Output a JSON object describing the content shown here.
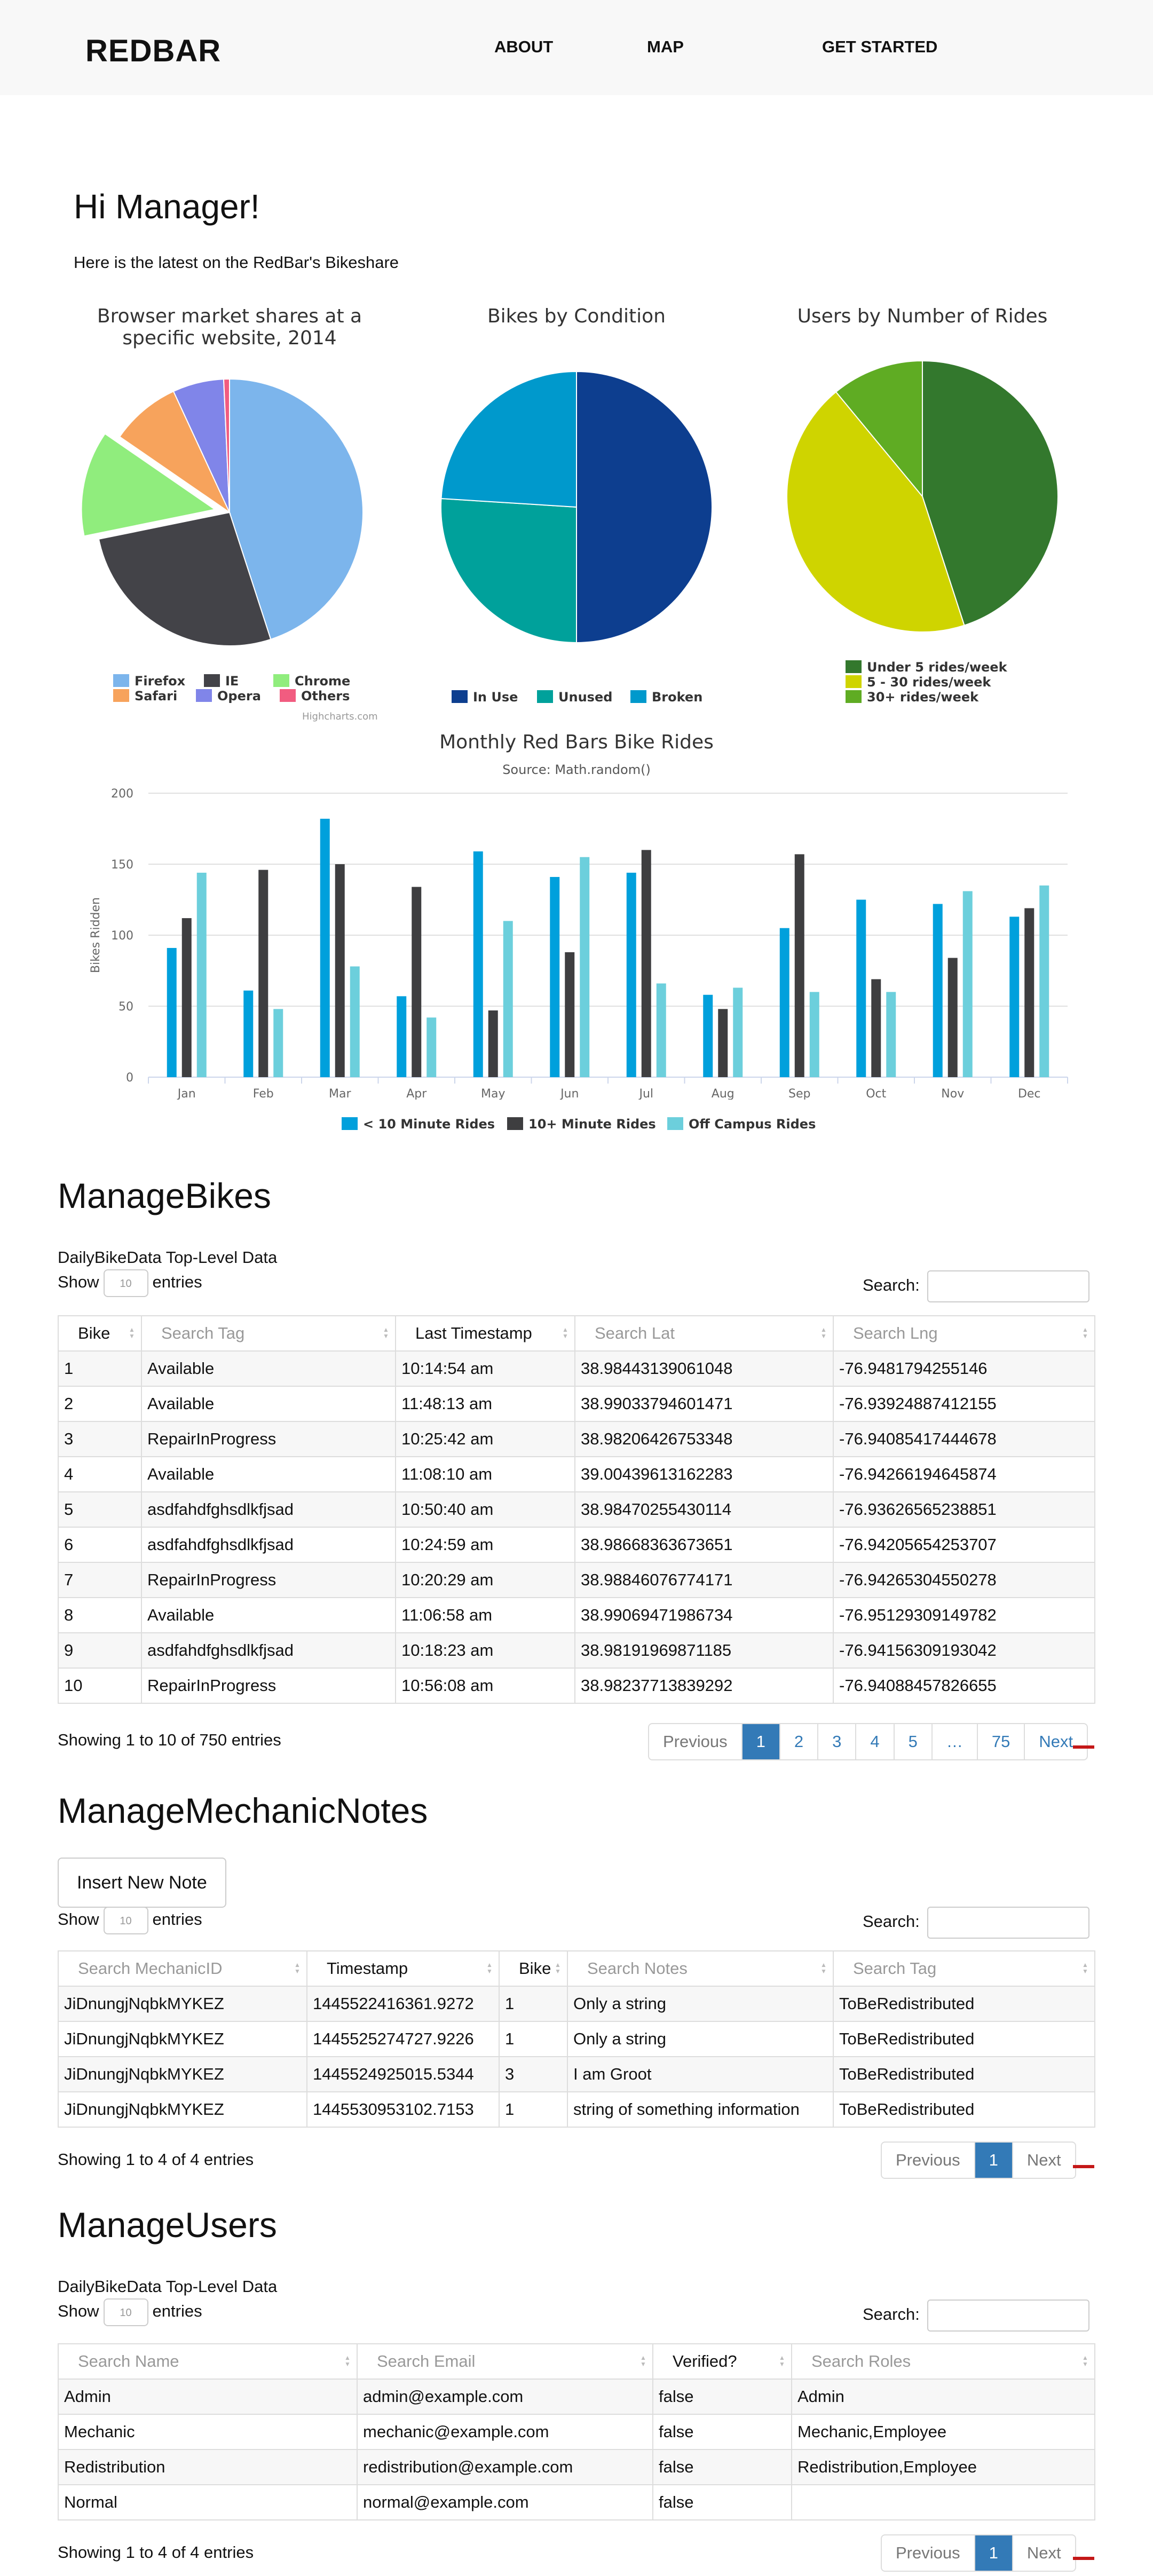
{
  "nav": {
    "brand": "REDBAR",
    "links": [
      "ABOUT",
      "MAP",
      "GET STARTED"
    ]
  },
  "header": {
    "greeting": "Hi Manager!",
    "subtitle": "Here is the latest on the RedBar's Bikeshare"
  },
  "colors": {
    "primary": "#337ab7",
    "red": "#c41818"
  },
  "pie_charts": [
    {
      "title": "Browser market shares at a specific website, 2014",
      "credits": "Highcharts.com",
      "chart_data": {
        "type": "pie",
        "slices": [
          {
            "label": "Firefox",
            "value": 45.0,
            "color": "#7cb5ec"
          },
          {
            "label": "IE",
            "value": 26.8,
            "color": "#434348"
          },
          {
            "label": "Chrome",
            "value": 12.8,
            "color": "#90ed7d",
            "sliced": true
          },
          {
            "label": "Safari",
            "value": 8.5,
            "color": "#f7a35c"
          },
          {
            "label": "Opera",
            "value": 6.2,
            "color": "#8085e9"
          },
          {
            "label": "Others",
            "value": 0.7,
            "color": "#f15c80"
          }
        ]
      }
    },
    {
      "title": "Bikes by Condition",
      "chart_data": {
        "type": "pie",
        "slices": [
          {
            "label": "In Use",
            "value": 50,
            "color": "#0d3e8f"
          },
          {
            "label": "Unused",
            "value": 26,
            "color": "#00a19b"
          },
          {
            "label": "Broken",
            "value": 24,
            "color": "#0099cc"
          }
        ]
      }
    },
    {
      "title": "Users by Number of Rides",
      "chart_data": {
        "type": "pie",
        "slices": [
          {
            "label": "Under 5 rides/week",
            "value": 45,
            "color": "#33782d"
          },
          {
            "label": "5 - 30 rides/week",
            "value": 44,
            "color": "#cfd400"
          },
          {
            "label": "30+ rides/week",
            "value": 11,
            "color": "#5fac23"
          }
        ]
      }
    }
  ],
  "bar_chart": {
    "title": "Monthly Red Bars Bike Rides",
    "subtitle": "Source: Math.random()",
    "chart_data": {
      "type": "bar",
      "ylabel": "Bikes Ridden",
      "ylim": [
        0,
        200
      ],
      "yticks": [
        0,
        50,
        100,
        150,
        200
      ],
      "categories": [
        "Jan",
        "Feb",
        "Mar",
        "Apr",
        "May",
        "Jun",
        "Jul",
        "Aug",
        "Sep",
        "Oct",
        "Nov",
        "Dec"
      ],
      "series": [
        {
          "name": "< 10 Minute Rides",
          "color": "#00a0dc",
          "values": [
            91,
            61,
            182,
            57,
            159,
            141,
            144,
            58,
            105,
            125,
            122,
            113
          ]
        },
        {
          "name": "10+ Minute Rides",
          "color": "#3e3e40",
          "values": [
            112,
            146,
            150,
            134,
            47,
            88,
            160,
            48,
            157,
            69,
            84,
            119
          ]
        },
        {
          "name": "Off Campus Rides",
          "color": "#6ccfdc",
          "values": [
            144,
            48,
            78,
            42,
            110,
            155,
            66,
            63,
            60,
            60,
            131,
            135
          ]
        }
      ]
    }
  },
  "bikes": {
    "title": "ManageBikes",
    "caption": "DailyBikeData Top-Level Data",
    "show_label": "Show",
    "entries_label": "entries",
    "length_value": "10",
    "search_label": "Search:",
    "columns": [
      {
        "label": "Bike",
        "search": false
      },
      {
        "label": "Search Tag",
        "search": true
      },
      {
        "label": "Last Timestamp",
        "search": false
      },
      {
        "label": "Search Lat",
        "search": true
      },
      {
        "label": "Search Lng",
        "search": true
      }
    ],
    "rows": [
      [
        "1",
        "Available",
        "10:14:54 am",
        "38.98443139061048",
        "-76.9481794255146"
      ],
      [
        "2",
        "Available",
        "11:48:13 am",
        "38.99033794601471",
        "-76.93924887412155"
      ],
      [
        "3",
        "RepairInProgress",
        "10:25:42 am",
        "38.98206426753348",
        "-76.94085417444678"
      ],
      [
        "4",
        "Available",
        "11:08:10 am",
        "39.00439613162283",
        "-76.94266194645874"
      ],
      [
        "5",
        "asdfahdfghsdlkfjsad",
        "10:50:40 am",
        "38.98470255430114",
        "-76.93626565238851"
      ],
      [
        "6",
        "asdfahdfghsdlkfjsad",
        "10:24:59 am",
        "38.98668363673651",
        "-76.94205654253707"
      ],
      [
        "7",
        "RepairInProgress",
        "10:20:29 am",
        "38.98846076774171",
        "-76.94265304550278"
      ],
      [
        "8",
        "Available",
        "11:06:58 am",
        "38.99069471986734",
        "-76.95129309149782"
      ],
      [
        "9",
        "asdfahdfghsdlkfjsad",
        "10:18:23 am",
        "38.98191969871185",
        "-76.94156309193042"
      ],
      [
        "10",
        "RepairInProgress",
        "10:56:08 am",
        "38.98237713839292",
        "-76.94088457826655"
      ]
    ],
    "info": "Showing 1 to 10 of 750 entries",
    "pages": [
      "Previous",
      "1",
      "2",
      "3",
      "4",
      "5",
      "…",
      "75",
      "Next"
    ],
    "active_page": "1"
  },
  "notes": {
    "title": "ManageMechanicNotes",
    "insert_button": "Insert New Note",
    "show_label": "Show",
    "entries_label": "entries",
    "length_value": "10",
    "search_label": "Search:",
    "columns": [
      {
        "label": "Search MechanicID",
        "search": true
      },
      {
        "label": "Timestamp",
        "search": false
      },
      {
        "label": "Bike",
        "search": false
      },
      {
        "label": "Search Notes",
        "search": true
      },
      {
        "label": "Search Tag",
        "search": true
      }
    ],
    "rows": [
      [
        "JiDnungjNqbkMYKEZ",
        "1445522416361.9272",
        "1",
        "Only a string",
        "ToBeRedistributed"
      ],
      [
        "JiDnungjNqbkMYKEZ",
        "1445525274727.9226",
        "1",
        "Only a string",
        "ToBeRedistributed"
      ],
      [
        "JiDnungjNqbkMYKEZ",
        "1445524925015.5344",
        "3",
        "I am Groot",
        "ToBeRedistributed"
      ],
      [
        "JiDnungjNqbkMYKEZ",
        "1445530953102.7153",
        "1",
        "string of something information",
        "ToBeRedistributed"
      ]
    ],
    "info": "Showing 1 to 4 of 4 entries",
    "pages": [
      "Previous",
      "1",
      "Next"
    ],
    "active_page": "1"
  },
  "users": {
    "title": "ManageUsers",
    "caption": "DailyBikeData Top-Level Data",
    "show_label": "Show",
    "entries_label": "entries",
    "length_value": "10",
    "search_label": "Search:",
    "columns": [
      {
        "label": "Search Name",
        "search": true
      },
      {
        "label": "Search Email",
        "search": true
      },
      {
        "label": "Verified?",
        "search": false
      },
      {
        "label": "Search Roles",
        "search": true
      }
    ],
    "rows": [
      [
        "Admin",
        "admin@example.com",
        "false",
        "Admin"
      ],
      [
        "Mechanic",
        "mechanic@example.com",
        "false",
        "Mechanic,Employee"
      ],
      [
        "Redistribution",
        "redistribution@example.com",
        "false",
        "Redistribution,Employee"
      ],
      [
        "Normal",
        "normal@example.com",
        "false",
        ""
      ]
    ],
    "info": "Showing 1 to 4 of 4 entries",
    "pages": [
      "Previous",
      "1",
      "Next"
    ],
    "active_page": "1"
  }
}
